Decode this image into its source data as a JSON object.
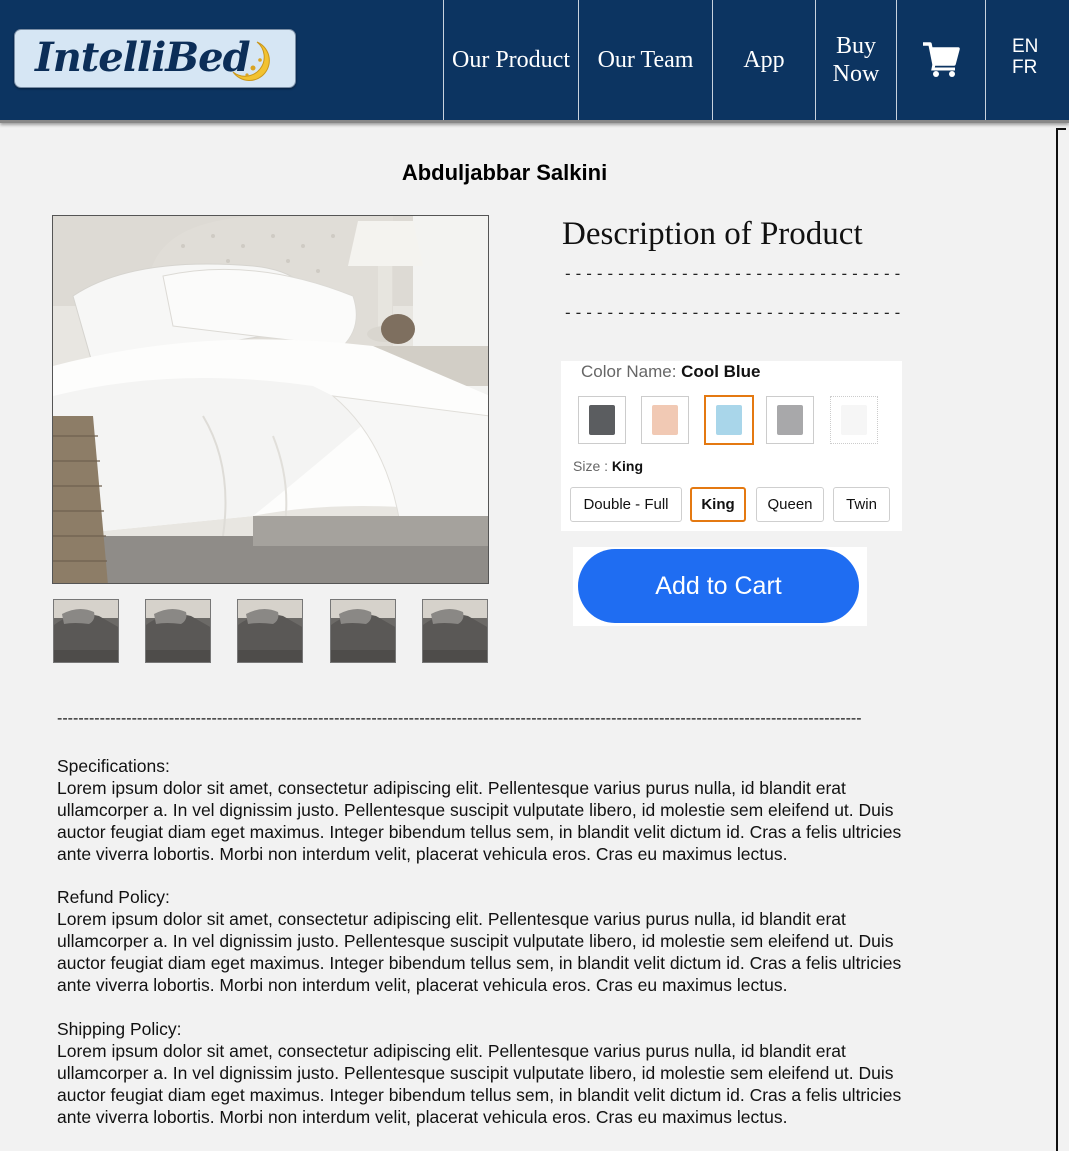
{
  "brand": {
    "logo_text": "IntelliBed"
  },
  "nav": {
    "items": [
      {
        "label": "Our Product"
      },
      {
        "label": "Our Team"
      },
      {
        "label": "App"
      },
      {
        "label_line1": "Buy",
        "label_line2": "Now"
      }
    ],
    "cart_icon": "shopping-cart-icon",
    "languages": [
      "EN",
      "FR"
    ]
  },
  "seller_name": "Abduljabbar Salkini",
  "product": {
    "description_title": "Description of Product",
    "dash_line": "--------------------------------",
    "color_label": "Color Name:",
    "color_value": "Cool Blue",
    "swatches": [
      {
        "name": "charcoal",
        "color": "#5b5d60"
      },
      {
        "name": "peach",
        "color": "#f1c9b4"
      },
      {
        "name": "cool-blue",
        "color": "#a9d6ea",
        "selected": true
      },
      {
        "name": "gray",
        "color": "#a8a8aa"
      },
      {
        "name": "white",
        "color": "#f6f6f6"
      }
    ],
    "size_label": "Size :",
    "size_value": "King",
    "sizes": [
      "Double - Full",
      "King",
      "Queen",
      "Twin"
    ],
    "add_to_cart": "Add to Cart"
  },
  "divider": "-------------------------------------------------------------------------------------------------------------------------------------------------------",
  "sections": [
    {
      "heading": "Specifications:",
      "lines": [
        "Lorem ipsum dolor sit amet, consectetur adipiscing elit. Pellentesque varius purus nulla, id blandit erat",
        "ullamcorper a. In vel dignissim justo. Pellentesque suscipit vulputate libero, id molestie sem eleifend ut. Duis",
        "auctor feugiat diam eget maximus. Integer bibendum tellus sem, in blandit velit dictum id. Cras a felis ultricies",
        "ante viverra lobortis. Morbi non interdum velit, placerat vehicula eros. Cras eu maximus lectus."
      ]
    },
    {
      "heading": "Refund Policy:",
      "lines": [
        "Lorem ipsum dolor sit amet, consectetur adipiscing elit. Pellentesque varius purus nulla, id blandit erat",
        "ullamcorper a. In vel dignissim justo. Pellentesque suscipit vulputate libero, id molestie sem eleifend ut. Duis",
        "auctor feugiat diam eget maximus. Integer bibendum tellus sem, in blandit velit dictum id. Cras a felis ultricies",
        "ante viverra lobortis. Morbi non interdum velit, placerat vehicula eros. Cras eu maximus lectus."
      ]
    },
    {
      "heading": "Shipping Policy:",
      "lines": [
        "Lorem ipsum dolor sit amet, consectetur adipiscing elit. Pellentesque varius purus nulla, id blandit erat",
        "ullamcorper a. In vel dignissim justo. Pellentesque suscipit vulputate libero, id molestie sem eleifend ut. Duis",
        "auctor feugiat diam eget maximus. Integer bibendum tellus sem, in blandit velit dictum id. Cras a felis ultricies",
        "ante viverra lobortis. Morbi non interdum velit, placerat vehicula eros. Cras eu maximus lectus."
      ]
    }
  ]
}
